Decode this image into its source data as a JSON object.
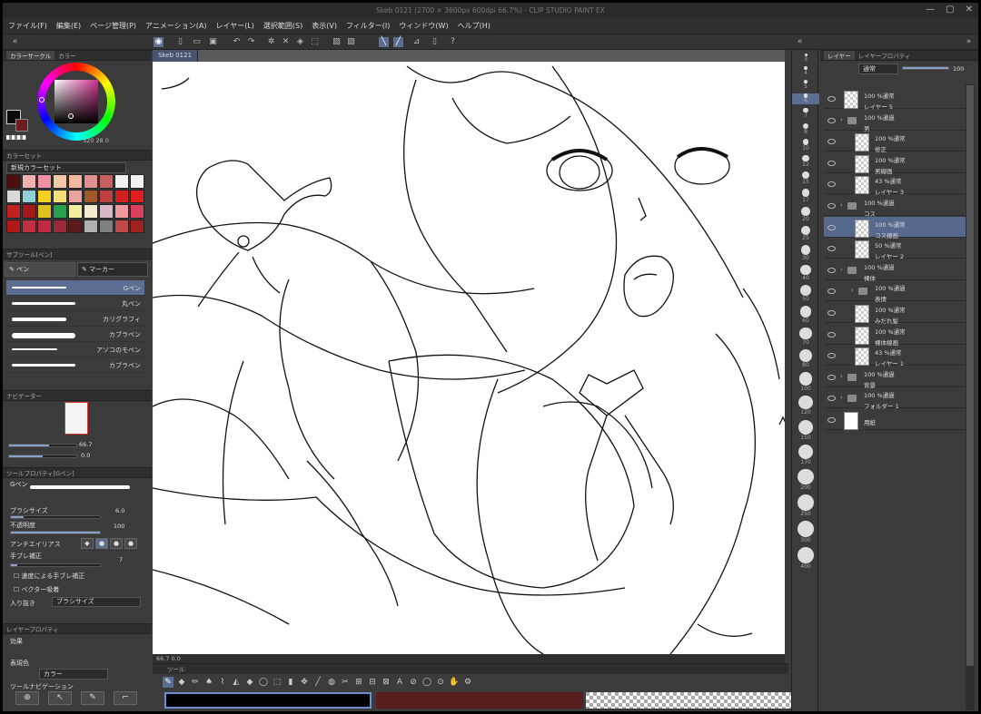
{
  "title": "Skeb 0121 (2700 × 3600px 600dpi 66.7%) - CLIP STUDIO PAINT EX",
  "menu": [
    "ファイル(F)",
    "編集(E)",
    "ページ管理(P)",
    "アニメーション(A)",
    "レイヤー(L)",
    "選択範囲(S)",
    "表示(V)",
    "フィルター(I)",
    "ウィンドウ(W)",
    "ヘルプ(H)"
  ],
  "colors": {
    "main": "#0a0a0a",
    "sub": "#6b1c1c",
    "accent": "#5b6e92"
  },
  "color_panel": {
    "tab1": "カラーサークル",
    "tab2": "カラー",
    "values": "320  28  0"
  },
  "color_set": {
    "header": "カラーセット",
    "set_name": "新規カラーセット",
    "swatches": [
      "#4d0e0e",
      "#f3b2b2",
      "#f090a5",
      "#f6c9a6",
      "#f4b8a0",
      "#e09090",
      "#c86060",
      "#f2f2f2",
      "#f2f2f2",
      "#d9d9d9",
      "#8fd0d6",
      "#f5d020",
      "#f4e07a",
      "#e9a4a0",
      "#a05a2a",
      "#c04040",
      "#d02020",
      "#e02020",
      "#c02020",
      "#a01818",
      "#e0c020",
      "#28a050",
      "#f0f0a0",
      "#f4ead0",
      "#d9b8c9",
      "#f09aa0",
      "#d94060",
      "#b01818",
      "#c03040",
      "#c02a40",
      "#9a2a3a",
      "#5a1a1a",
      "#b0b0b0",
      "#808080",
      "#c04a4a",
      "#a02020"
    ]
  },
  "subtool": {
    "header": "サブツール[ペン]",
    "tab_pen": "ペン",
    "tab_marker": "マーカー",
    "brushes": [
      "Gペン",
      "丸ペン",
      "カリグラフィ",
      "カブラペン",
      "アソコのモペン",
      "カブラペン"
    ]
  },
  "navigator": {
    "header": "ナビゲーター",
    "zoom": "66.7",
    "angle": "0.0"
  },
  "tool_property": {
    "header": "ツールプロパティ[Gペン]",
    "tool": "Gペン",
    "brush_size_label": "ブラシサイズ",
    "brush_size": "6.0",
    "opacity_label": "不透明度",
    "opacity": "100",
    "antialias_label": "アンチエイリアス",
    "stabilize_label": "手ブレ補正",
    "stabilize": "7",
    "speed_stabilize": "速度による手ブレ補正",
    "vector_snap": "ベクター吸着",
    "taper_label": "入り抜き",
    "taper_value": "ブラシサイズ"
  },
  "layer_property": {
    "header": "レイヤープロパティ",
    "effect": "効果",
    "expr_color": "表現色",
    "expr_value": "カラー",
    "tool_nav": "ツールナビゲーション"
  },
  "canvas": {
    "tab": "Skeb 0121",
    "status": "66.7                    0.0"
  },
  "toolbar_header": "ツール",
  "brush_sizes": [
    "3",
    "4",
    "5",
    "6",
    "7",
    "8",
    "10",
    "12",
    "15",
    "17",
    "20",
    "25",
    "30",
    "40",
    "50",
    "60",
    "70",
    "80",
    "100",
    "120",
    "150",
    "170",
    "200",
    "250",
    "300",
    "400"
  ],
  "active_size": "6",
  "layer_panel": {
    "tab1": "レイヤー",
    "tab2": "レイヤープロパティ",
    "blend": "通常",
    "opacity": "100",
    "layers": [
      {
        "mode": "100 %通常",
        "name": "レイヤー 5",
        "kind": "layer",
        "indent": 0
      },
      {
        "mode": "100 %通過",
        "name": "男",
        "kind": "folder",
        "indent": 0
      },
      {
        "mode": "100 %通常",
        "name": "修正",
        "kind": "layer",
        "indent": 1
      },
      {
        "mode": "100 %通常",
        "name": "男線画",
        "kind": "layer",
        "indent": 1
      },
      {
        "mode": "43 %通常",
        "name": "レイヤー 3",
        "kind": "layer",
        "indent": 1
      },
      {
        "mode": "100 %通過",
        "name": "コス",
        "kind": "folder",
        "indent": 0
      },
      {
        "mode": "100 %通常",
        "name": "コス線画",
        "kind": "layer",
        "indent": 1,
        "selected": true
      },
      {
        "mode": "50 %通常",
        "name": "レイヤー 2",
        "kind": "layer",
        "indent": 1
      },
      {
        "mode": "100 %通過",
        "name": "裸体",
        "kind": "folder",
        "indent": 0
      },
      {
        "mode": "100 %通過",
        "name": "表情",
        "kind": "folder",
        "indent": 1
      },
      {
        "mode": "100 %通常",
        "name": "みだれ髪",
        "kind": "layer",
        "indent": 1
      },
      {
        "mode": "100 %通常",
        "name": "裸体線画",
        "kind": "layer",
        "indent": 1
      },
      {
        "mode": "43 %通常",
        "name": "レイヤー 1",
        "kind": "layer",
        "indent": 1
      },
      {
        "mode": "100 %通過",
        "name": "背景",
        "kind": "folder",
        "indent": 0
      },
      {
        "mode": "100 %通過",
        "name": "フォルダー 1",
        "kind": "folder",
        "indent": 0
      },
      {
        "mode": "",
        "name": "用紙",
        "kind": "paper",
        "indent": 0
      }
    ]
  }
}
